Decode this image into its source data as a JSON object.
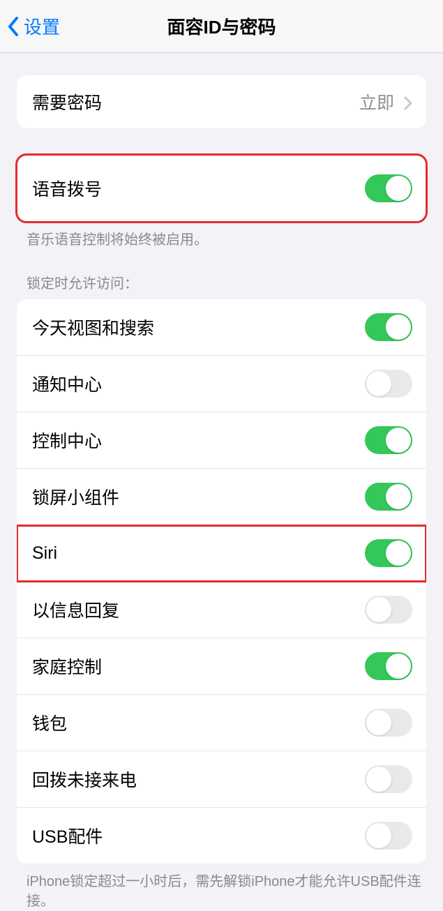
{
  "header": {
    "back_label": "设置",
    "title": "面容ID与密码"
  },
  "require_passcode": {
    "label": "需要密码",
    "value": "立即"
  },
  "voice_dial": {
    "label": "语音拨号",
    "on": true,
    "footer": "音乐语音控制将始终被启用。"
  },
  "lock_access": {
    "header": "锁定时允许访问：",
    "items": [
      {
        "label": "今天视图和搜索",
        "on": true,
        "name": "today-view-toggle"
      },
      {
        "label": "通知中心",
        "on": false,
        "name": "notification-center-toggle"
      },
      {
        "label": "控制中心",
        "on": true,
        "name": "control-center-toggle"
      },
      {
        "label": "锁屏小组件",
        "on": true,
        "name": "lock-widget-toggle"
      },
      {
        "label": "Siri",
        "on": true,
        "name": "siri-toggle",
        "highlight": true
      },
      {
        "label": "以信息回复",
        "on": false,
        "name": "reply-message-toggle"
      },
      {
        "label": "家庭控制",
        "on": true,
        "name": "home-control-toggle"
      },
      {
        "label": "钱包",
        "on": false,
        "name": "wallet-toggle"
      },
      {
        "label": "回拨未接来电",
        "on": false,
        "name": "return-call-toggle"
      },
      {
        "label": "USB配件",
        "on": false,
        "name": "usb-accessory-toggle"
      }
    ],
    "footer": "iPhone锁定超过一小时后，需先解锁iPhone才能允许USB配件连接。"
  }
}
